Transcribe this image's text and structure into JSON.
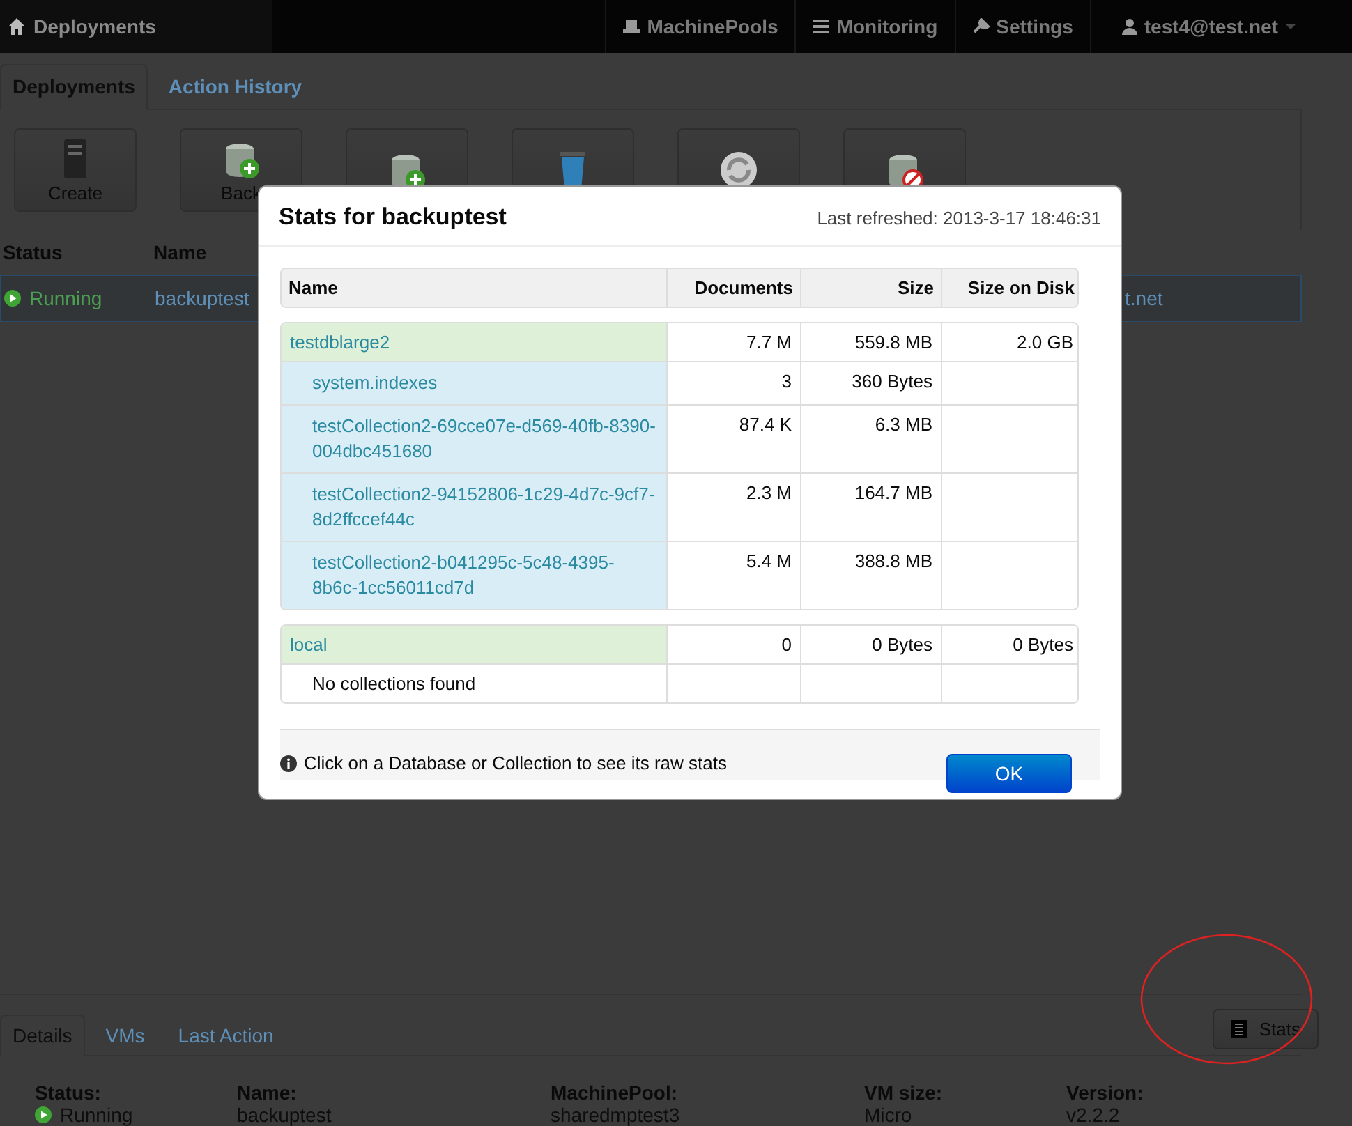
{
  "navbar": {
    "brand": "Deployments",
    "links": [
      {
        "label": "MachinePools",
        "kind": "pools"
      },
      {
        "label": "Monitoring",
        "kind": "monitor"
      },
      {
        "label": "Settings",
        "kind": "settings"
      },
      {
        "label": "test4@test.net",
        "kind": "user"
      }
    ]
  },
  "tabs": [
    {
      "label": "Deployments",
      "selected": true
    },
    {
      "label": "Action History",
      "selected": false
    }
  ],
  "toolbar": [
    {
      "label": "Create",
      "kind": "server"
    },
    {
      "label": "Back",
      "kind": "db-add"
    },
    {
      "kind": "db-add"
    },
    {
      "kind": "trash"
    },
    {
      "kind": "refresh"
    },
    {
      "kind": "db-delete"
    }
  ],
  "deployments": {
    "columns": [
      "Status",
      "Name"
    ],
    "rows": [
      {
        "status": "Running",
        "name": "backuptest",
        "column_3": "t.net",
        "selected": true
      }
    ]
  },
  "details": {
    "tabs": [
      {
        "label": "Details",
        "selected": true
      },
      {
        "label": "VMs",
        "selected": false
      },
      {
        "label": "Last Action",
        "selected": false
      }
    ],
    "stats_button": "Stats",
    "fields": [
      {
        "label": "Status:",
        "value": "Running",
        "kind": "status"
      },
      {
        "label": "Name:",
        "value": "backuptest",
        "kind": "text"
      },
      {
        "label": "MachinePool:",
        "value": "sharedmptest3",
        "kind": "text"
      },
      {
        "label": "VM size:",
        "value": "Micro",
        "kind": "text"
      },
      {
        "label": "Version:",
        "value": "v2.2.2",
        "kind": "text"
      }
    ]
  },
  "modal": {
    "title": "Stats for backuptest",
    "refreshed": "Last refreshed: 2013-3-17 18:46:31",
    "columns": [
      "Name",
      "Documents",
      "Size",
      "Size on Disk"
    ],
    "databases": [
      {
        "name": "testdblarge2",
        "documents": "7.7 M",
        "size": "559.8 MB",
        "size_on_disk": "2.0 GB",
        "collections": [
          {
            "name": "system.indexes",
            "documents": "3",
            "size": "360 Bytes"
          },
          {
            "name": "testCollection2-69cce07e-d569-40fb-8390-004dbc451680",
            "documents": "87.4 K",
            "size": "6.3 MB"
          },
          {
            "name": "testCollection2-94152806-1c29-4d7c-9cf7-8d2ffccef44c",
            "documents": "2.3 M",
            "size": "164.7 MB"
          },
          {
            "name": "testCollection2-b041295c-5c48-4395-8b6c-1cc56011cd7d",
            "documents": "5.4 M",
            "size": "388.8 MB"
          }
        ]
      },
      {
        "name": "local",
        "documents": "0",
        "size": "0 Bytes",
        "size_on_disk": "0 Bytes",
        "empty_note": "No collections found"
      }
    ],
    "hint": "Click on a Database or Collection to see its raw stats",
    "ok": "OK"
  }
}
